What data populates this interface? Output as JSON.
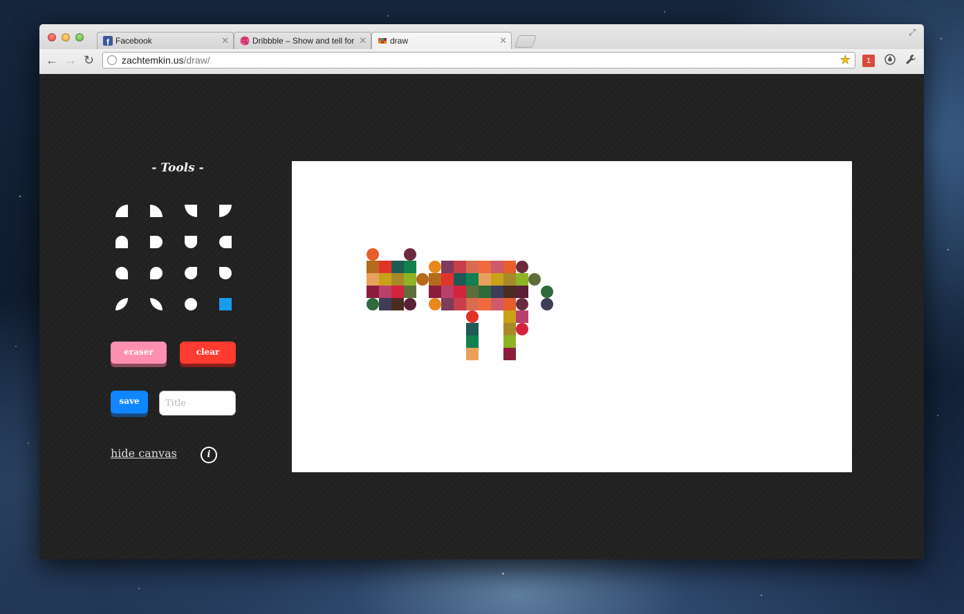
{
  "browser": {
    "tabs": [
      {
        "label": "Facebook",
        "icon": "facebook-icon",
        "active": false
      },
      {
        "label": "Dribbble – Show and tell for designers",
        "icon": "dribbble-icon",
        "active": false
      },
      {
        "label": "draw",
        "icon": "draw-favicon",
        "active": true
      }
    ],
    "url_host": "zachtemkin.us",
    "url_path": "/draw/",
    "extension_badge": "1"
  },
  "sidebar": {
    "title": "- Tools -",
    "eraser_label": "eraser",
    "clear_label": "clear",
    "save_label": "save",
    "title_placeholder": "Title",
    "hide_canvas_label": "hide canvas",
    "info_label": "i",
    "shape_tools": [
      "quarter-circle-bottom-right-tool",
      "quarter-circle-bottom-left-tool",
      "quarter-circle-top-left-tool",
      "quarter-circle-top-right-tool",
      "round-top-tool",
      "round-right-tool",
      "round-bottom-tool",
      "round-left-tool",
      "round-except-bottom-right-tool",
      "round-except-bottom-left-tool",
      "round-except-top-right-tool",
      "round-except-top-left-tool",
      "leaf-right-tool",
      "leaf-left-tool",
      "circle-tool",
      "square-tool"
    ],
    "selected_tool": "square-tool",
    "selected_color": "#1a9bf0"
  },
  "colors": {
    "eraser": "#ff8fb1",
    "clear": "#ff3b30",
    "save": "#0f86ff",
    "selected_square": "#1a9bf0"
  }
}
